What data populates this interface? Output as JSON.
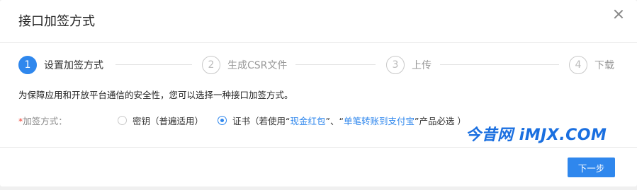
{
  "modal": {
    "title": "接口加签方式",
    "close_icon": "close-icon"
  },
  "steps": [
    {
      "number": "1",
      "label": "设置加签方式",
      "active": true
    },
    {
      "number": "2",
      "label": "生成CSR文件",
      "active": false
    },
    {
      "number": "3",
      "label": "上传",
      "active": false
    },
    {
      "number": "4",
      "label": "下载",
      "active": false
    }
  ],
  "description": "为保障应用和开放平台通信的安全性，您可以选择一种接口加签方式。",
  "form": {
    "required_mark": "*",
    "label": "加签方式：",
    "options": {
      "key": {
        "label": "密钥（普遍适用）",
        "checked": false
      },
      "cert": {
        "prefix": "证书（若使用“",
        "link1": "现金红包",
        "mid": "”、“",
        "link2": "单笔转账到支付宝",
        "suffix": "”产品必选 ）",
        "checked": true
      }
    }
  },
  "watermark": "今昔网 iMJX.COM",
  "footer": {
    "next_label": "下一步"
  },
  "colors": {
    "accent": "#2f87ed",
    "required": "#f04134"
  }
}
